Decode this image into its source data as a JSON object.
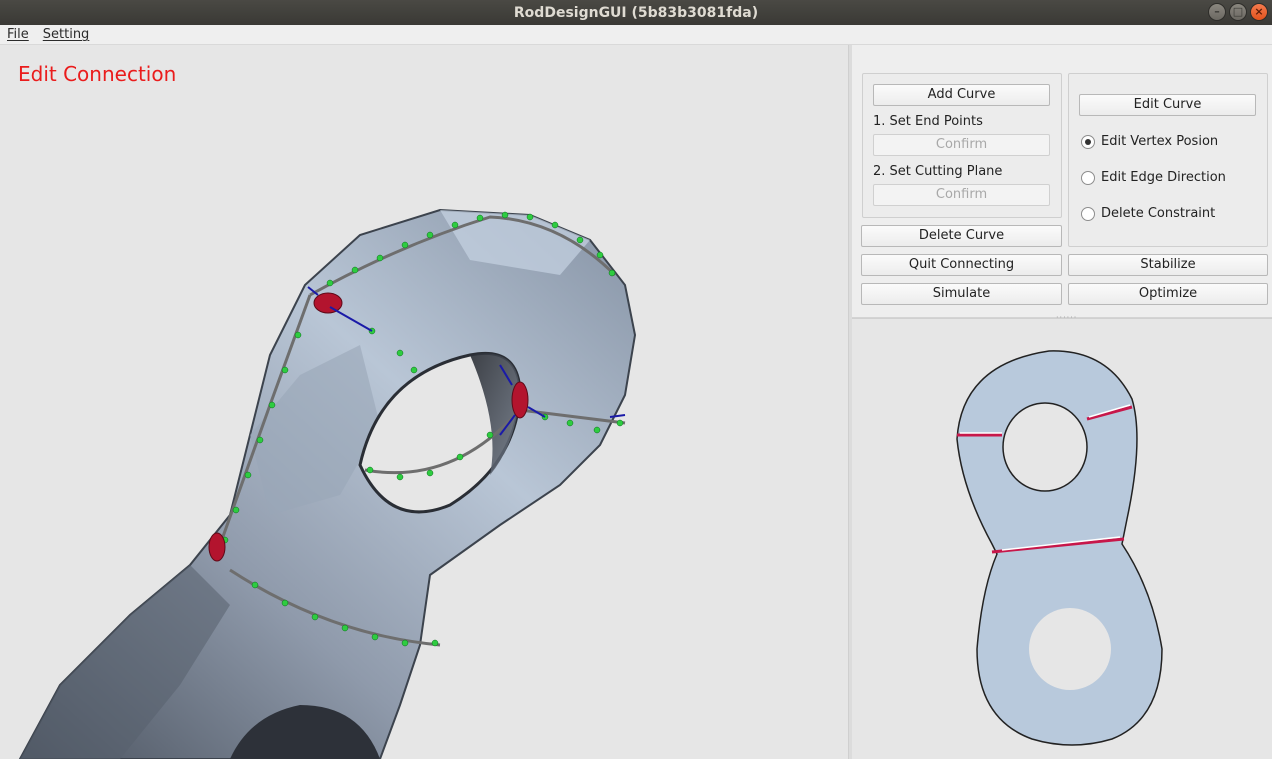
{
  "window": {
    "title": "RodDesignGUI (5b83b3081fda)"
  },
  "menu": {
    "file": "File",
    "setting": "Setting"
  },
  "viewport": {
    "mode_title": "Edit Connection",
    "mesh_color": "#a9b6c8",
    "mode_title_color": "#ea1c1c"
  },
  "panel": {
    "add_curve": "Add Curve",
    "step1_label": "1. Set End Points",
    "confirm1": "Confirm",
    "step2_label": "2. Set Cutting Plane",
    "confirm2": "Confirm",
    "edit_curve": "Edit Curve",
    "radio_options": [
      {
        "label": "Edit Vertex Posion",
        "checked": true
      },
      {
        "label": "Edit Edge Direction",
        "checked": false
      },
      {
        "label": "Delete Constraint",
        "checked": false
      }
    ],
    "delete_curve": "Delete Curve",
    "quit_connecting": "Quit Connecting",
    "stabilize": "Stabilize",
    "simulate": "Simulate",
    "optimize": "Optimize"
  },
  "preview": {
    "fill_color": "#b8c9dc"
  }
}
